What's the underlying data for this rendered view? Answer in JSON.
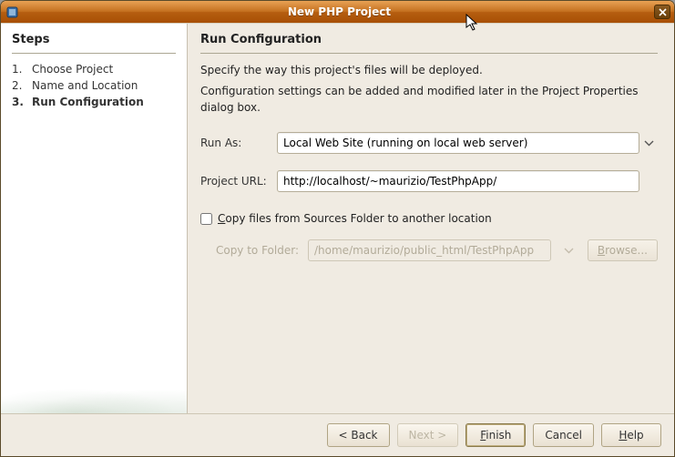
{
  "titlebar": {
    "title": "New PHP Project"
  },
  "sidebar": {
    "header": "Steps",
    "steps": [
      {
        "num": "1.",
        "label": "Choose Project",
        "current": false
      },
      {
        "num": "2.",
        "label": "Name and Location",
        "current": false
      },
      {
        "num": "3.",
        "label": "Run Configuration",
        "current": true
      }
    ]
  },
  "main": {
    "header": "Run Configuration",
    "desc1": "Specify the way this project's files will be deployed.",
    "desc2": "Configuration settings can be added and modified later in the Project Properties dialog box.",
    "runAsLabel": "Run As:",
    "runAsValue": "Local Web Site (running on local web server)",
    "projectUrlLabel": "Project URL:",
    "projectUrlValue": "http://localhost/~maurizio/TestPhpApp/",
    "copyCheckboxLabel": "Copy files from Sources Folder to another location",
    "copyFolderLabel": "Copy to Folder:",
    "copyFolderValue": "/home/maurizio/public_html/TestPhpApp",
    "browseLabel": "Browse..."
  },
  "footer": {
    "back": "< Back",
    "next": "Next >",
    "finish": "Finish",
    "cancel": "Cancel",
    "help": "Help"
  }
}
